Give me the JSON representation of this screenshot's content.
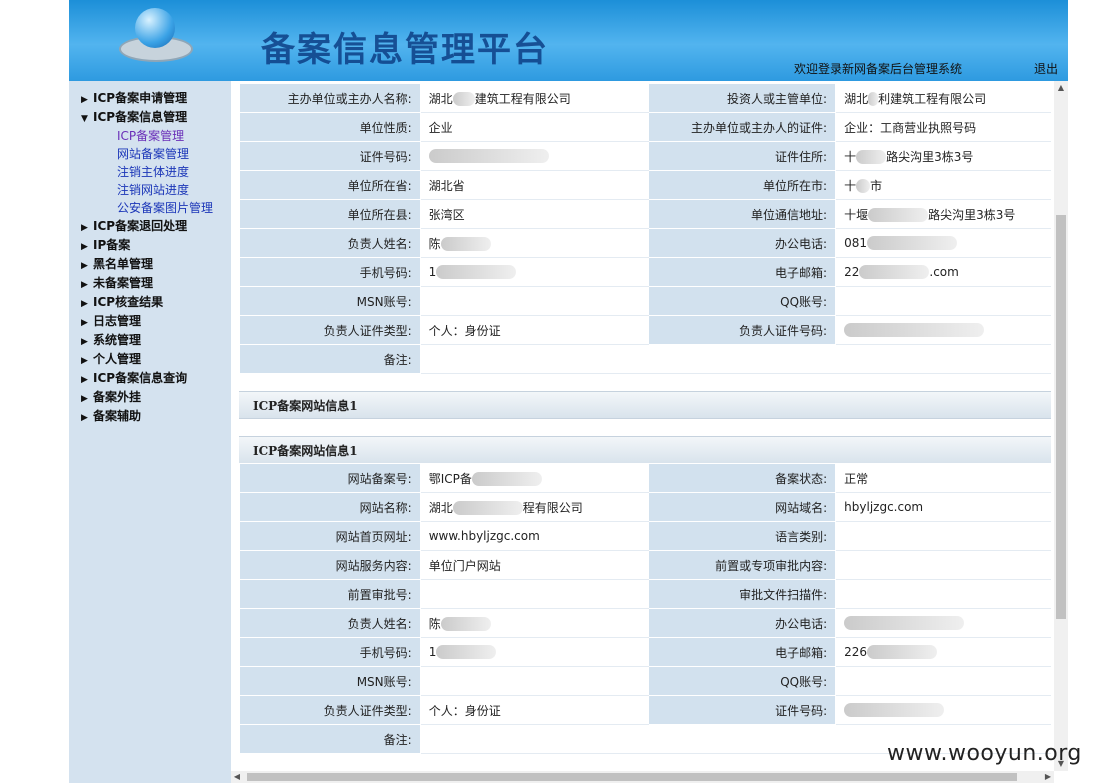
{
  "header": {
    "title": "备案信息管理平台",
    "welcome": "欢迎登录新网备案后台管理系统",
    "logout": "退出"
  },
  "sidebar": {
    "items": [
      {
        "label": "ICP备案申请管理"
      },
      {
        "label": "ICP备案信息管理",
        "expanded": true
      },
      {
        "label": "ICP备案管理",
        "sub": true
      },
      {
        "label": "网站备案管理",
        "sub": true
      },
      {
        "label": "注销主体进度",
        "sub": true
      },
      {
        "label": "注销网站进度",
        "sub": true
      },
      {
        "label": "公安备案图片管理",
        "sub": true
      },
      {
        "label": "ICP备案退回处理"
      },
      {
        "label": "IP备案"
      },
      {
        "label": "黑名单管理"
      },
      {
        "label": "未备案管理"
      },
      {
        "label": "ICP核查结果"
      },
      {
        "label": "日志管理"
      },
      {
        "label": "系统管理"
      },
      {
        "label": "个人管理"
      },
      {
        "label": "ICP备案信息查询"
      },
      {
        "label": "备案外挂"
      },
      {
        "label": "备案辅助"
      }
    ]
  },
  "entity": {
    "rows": [
      [
        {
          "l": "主办单位或主办人名称:",
          "v": "湖北",
          "b": 22,
          "v2": "建筑工程有限公司"
        },
        {
          "l": "投资人或主管单位:",
          "v": "湖北",
          "b": 10,
          "v2": "利建筑工程有限公司"
        }
      ],
      [
        {
          "l": "单位性质:",
          "v": "企业"
        },
        {
          "l": "主办单位或主办人的证件:",
          "v": "企业：工商营业执照号码"
        }
      ],
      [
        {
          "l": "证件号码:",
          "v": "",
          "b": 120
        },
        {
          "l": "证件住所:",
          "v": "十",
          "b": 30,
          "v2": "路尖沟里3栋3号"
        }
      ],
      [
        {
          "l": "单位所在省:",
          "v": "湖北省"
        },
        {
          "l": "单位所在市:",
          "v": "十",
          "b": 14,
          "v2": "市"
        }
      ],
      [
        {
          "l": "单位所在县:",
          "v": "张湾区"
        },
        {
          "l": "单位通信地址:",
          "v": "十堰",
          "b": 60,
          "v2": "路尖沟里3栋3号"
        }
      ],
      [
        {
          "l": "负责人姓名:",
          "v": "陈",
          "b": 50
        },
        {
          "l": "办公电话:",
          "v": "081",
          "b": 90
        }
      ],
      [
        {
          "l": "手机号码:",
          "v": "1",
          "b": 80
        },
        {
          "l": "电子邮箱:",
          "v": "22",
          "b": 70,
          "v2": ".com"
        }
      ],
      [
        {
          "l": "MSN账号:",
          "v": ""
        },
        {
          "l": "QQ账号:",
          "v": ""
        }
      ],
      [
        {
          "l": "负责人证件类型:",
          "v": "个人：身份证"
        },
        {
          "l": "负责人证件号码:",
          "v": "",
          "b": 140
        }
      ],
      [
        {
          "l": "备注:",
          "v": "",
          "full": true
        }
      ]
    ]
  },
  "sections": {
    "site1": "ICP备案网站信息1",
    "site1b": "ICP备案网站信息1"
  },
  "website": {
    "rows": [
      [
        {
          "l": "网站备案号:",
          "v": "鄂ICP备",
          "b": 70
        },
        {
          "l": "备案状态:",
          "v": "正常"
        }
      ],
      [
        {
          "l": "网站名称:",
          "v": "湖北",
          "b": 70,
          "v2": "程有限公司"
        },
        {
          "l": "网站域名:",
          "v": "hbyljzgc.com"
        }
      ],
      [
        {
          "l": "网站首页网址:",
          "v": "www.hbyljzgc.com"
        },
        {
          "l": "语言类别:",
          "v": ""
        }
      ],
      [
        {
          "l": "网站服务内容:",
          "v": "单位门户网站"
        },
        {
          "l": "前置或专项审批内容:",
          "v": ""
        }
      ],
      [
        {
          "l": "前置审批号:",
          "v": ""
        },
        {
          "l": "审批文件扫描件:",
          "v": ""
        }
      ],
      [
        {
          "l": "负责人姓名:",
          "v": "陈",
          "b": 50
        },
        {
          "l": "办公电话:",
          "v": "",
          "b": 120
        }
      ],
      [
        {
          "l": "手机号码:",
          "v": "1",
          "b": 60
        },
        {
          "l": "电子邮箱:",
          "v": "226",
          "b": 70
        }
      ],
      [
        {
          "l": "MSN账号:",
          "v": ""
        },
        {
          "l": "QQ账号:",
          "v": ""
        }
      ],
      [
        {
          "l": "负责人证件类型:",
          "v": "个人：身份证"
        },
        {
          "l": "证件号码:",
          "v": "",
          "b": 100
        }
      ],
      [
        {
          "l": "备注:",
          "v": "",
          "full": true
        }
      ]
    ]
  },
  "watermark": "www.wooyun.org"
}
